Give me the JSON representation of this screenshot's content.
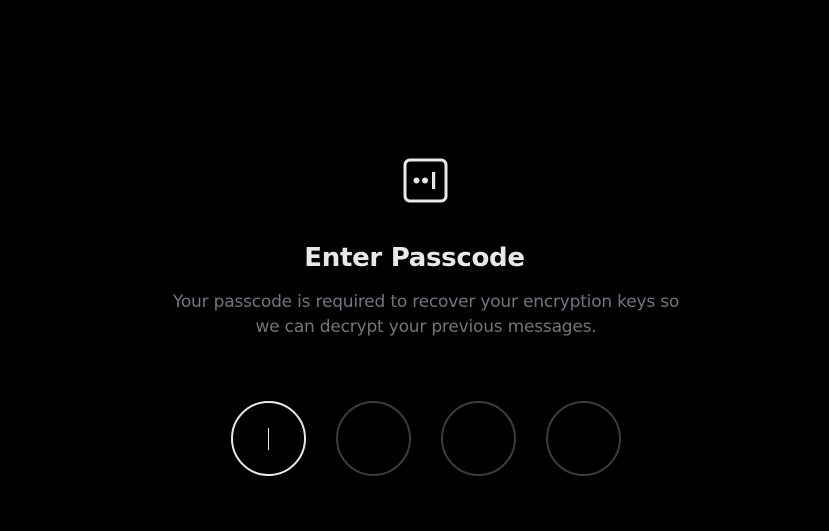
{
  "screen": {
    "title": "Enter Passcode",
    "description": "Your passcode is required to recover your encryption keys so we can decrypt your previous messages.",
    "icon": "passcode-icon"
  },
  "passcode": {
    "length": 4,
    "active_index": 0,
    "digits": [
      "",
      "",
      "",
      ""
    ]
  },
  "colors": {
    "background": "#000000",
    "title": "#e7e9ea",
    "description": "#71767b",
    "active_border": "#e7e9ea",
    "inactive_border": "#3a3d40"
  }
}
